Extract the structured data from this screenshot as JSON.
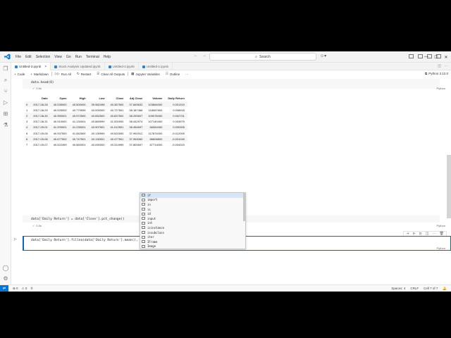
{
  "menu": [
    "File",
    "Edit",
    "Selection",
    "View",
    "Go",
    "Run",
    "Terminal",
    "Help"
  ],
  "search": "Search",
  "tabs": [
    {
      "label": "Untitled-3.ipynb",
      "active": true
    },
    {
      "label": "Stock Analysis Updated.ipynb",
      "active": false
    },
    {
      "label": "Untitled-2.ipynb",
      "active": false
    },
    {
      "label": "Untitled-1.ipynb",
      "active": false
    }
  ],
  "toolbar": {
    "code": "Code",
    "markdown": "Markdown",
    "run_all": "Run All",
    "restart": "Restart",
    "clear_outputs": "Clear All Outputs",
    "variables": "Jupyter Variables",
    "outline": "Outline",
    "kernel": "Python 3.12.0"
  },
  "cell1": {
    "code": "data.head(8)",
    "time": "0.0s",
    "lang": "Python"
  },
  "dataframe": {
    "columns": [
      "",
      "Date",
      "Open",
      "High",
      "Low",
      "Close",
      "Adj Close",
      "Volume",
      "Daily Return"
    ],
    "rows": [
      [
        "0",
        "2017-08-28",
        "40.035000",
        "40.500000",
        "39.982498",
        "40.367500",
        "37.849632",
        "103864000",
        "0.001319"
      ],
      [
        "1",
        "2017-08-29",
        "40.025002",
        "40.779999",
        "40.000000",
        "40.727501",
        "38.187466",
        "118067600",
        "0.008918"
      ],
      [
        "2",
        "2017-08-30",
        "40.950001",
        "40.972500",
        "40.652500",
        "40.837502",
        "38.290607",
        "109078400",
        "0.002701"
      ],
      [
        "3",
        "2017-08-31",
        "40.910000",
        "41.130001",
        "40.869999",
        "41.000000",
        "38.442974",
        "107140400",
        "0.003979"
      ],
      [
        "4",
        "2017-09-01",
        "41.200001",
        "41.235001",
        "40.907501",
        "41.012501",
        "38.454697",
        "66364400",
        "0.000305"
      ],
      [
        "5",
        "2017-09-05",
        "40.937500",
        "41.062500",
        "40.139999",
        "40.520000",
        "37.992912",
        "117874000",
        "-0.012009"
      ],
      [
        "6",
        "2017-09-06",
        "40.677502",
        "40.747501",
        "40.130001",
        "40.477501",
        "37.953060",
        "86606800",
        "-0.001049"
      ],
      [
        "7",
        "2017-09-07",
        "40.522499",
        "40.560001",
        "40.090000",
        "40.314999",
        "37.800697",
        "87714000",
        "-0.004015"
      ]
    ]
  },
  "cell2": {
    "code": "data['Daily Return'] = data['Close'].pct_change()",
    "time": "0.0s",
    "lang": "Python"
  },
  "cell3": {
    "code": "data['Daily Return'].fillna(data['Daily Return'].mean(), in)",
    "lang": "Python"
  },
  "suggestions": [
    "if",
    "import",
    "in",
    "is",
    "id",
    "input",
    "int",
    "isinstance",
    "issubclass",
    "iter",
    "IFrame",
    "Image"
  ],
  "status": {
    "errors": "0",
    "warnings": "0",
    "spaces": "Spaces: 4",
    "eol": "CRLF",
    "cell": "Cell 7 of 7"
  },
  "colors": {
    "accent": "#0078d4",
    "active_border": "#0a64c8"
  }
}
